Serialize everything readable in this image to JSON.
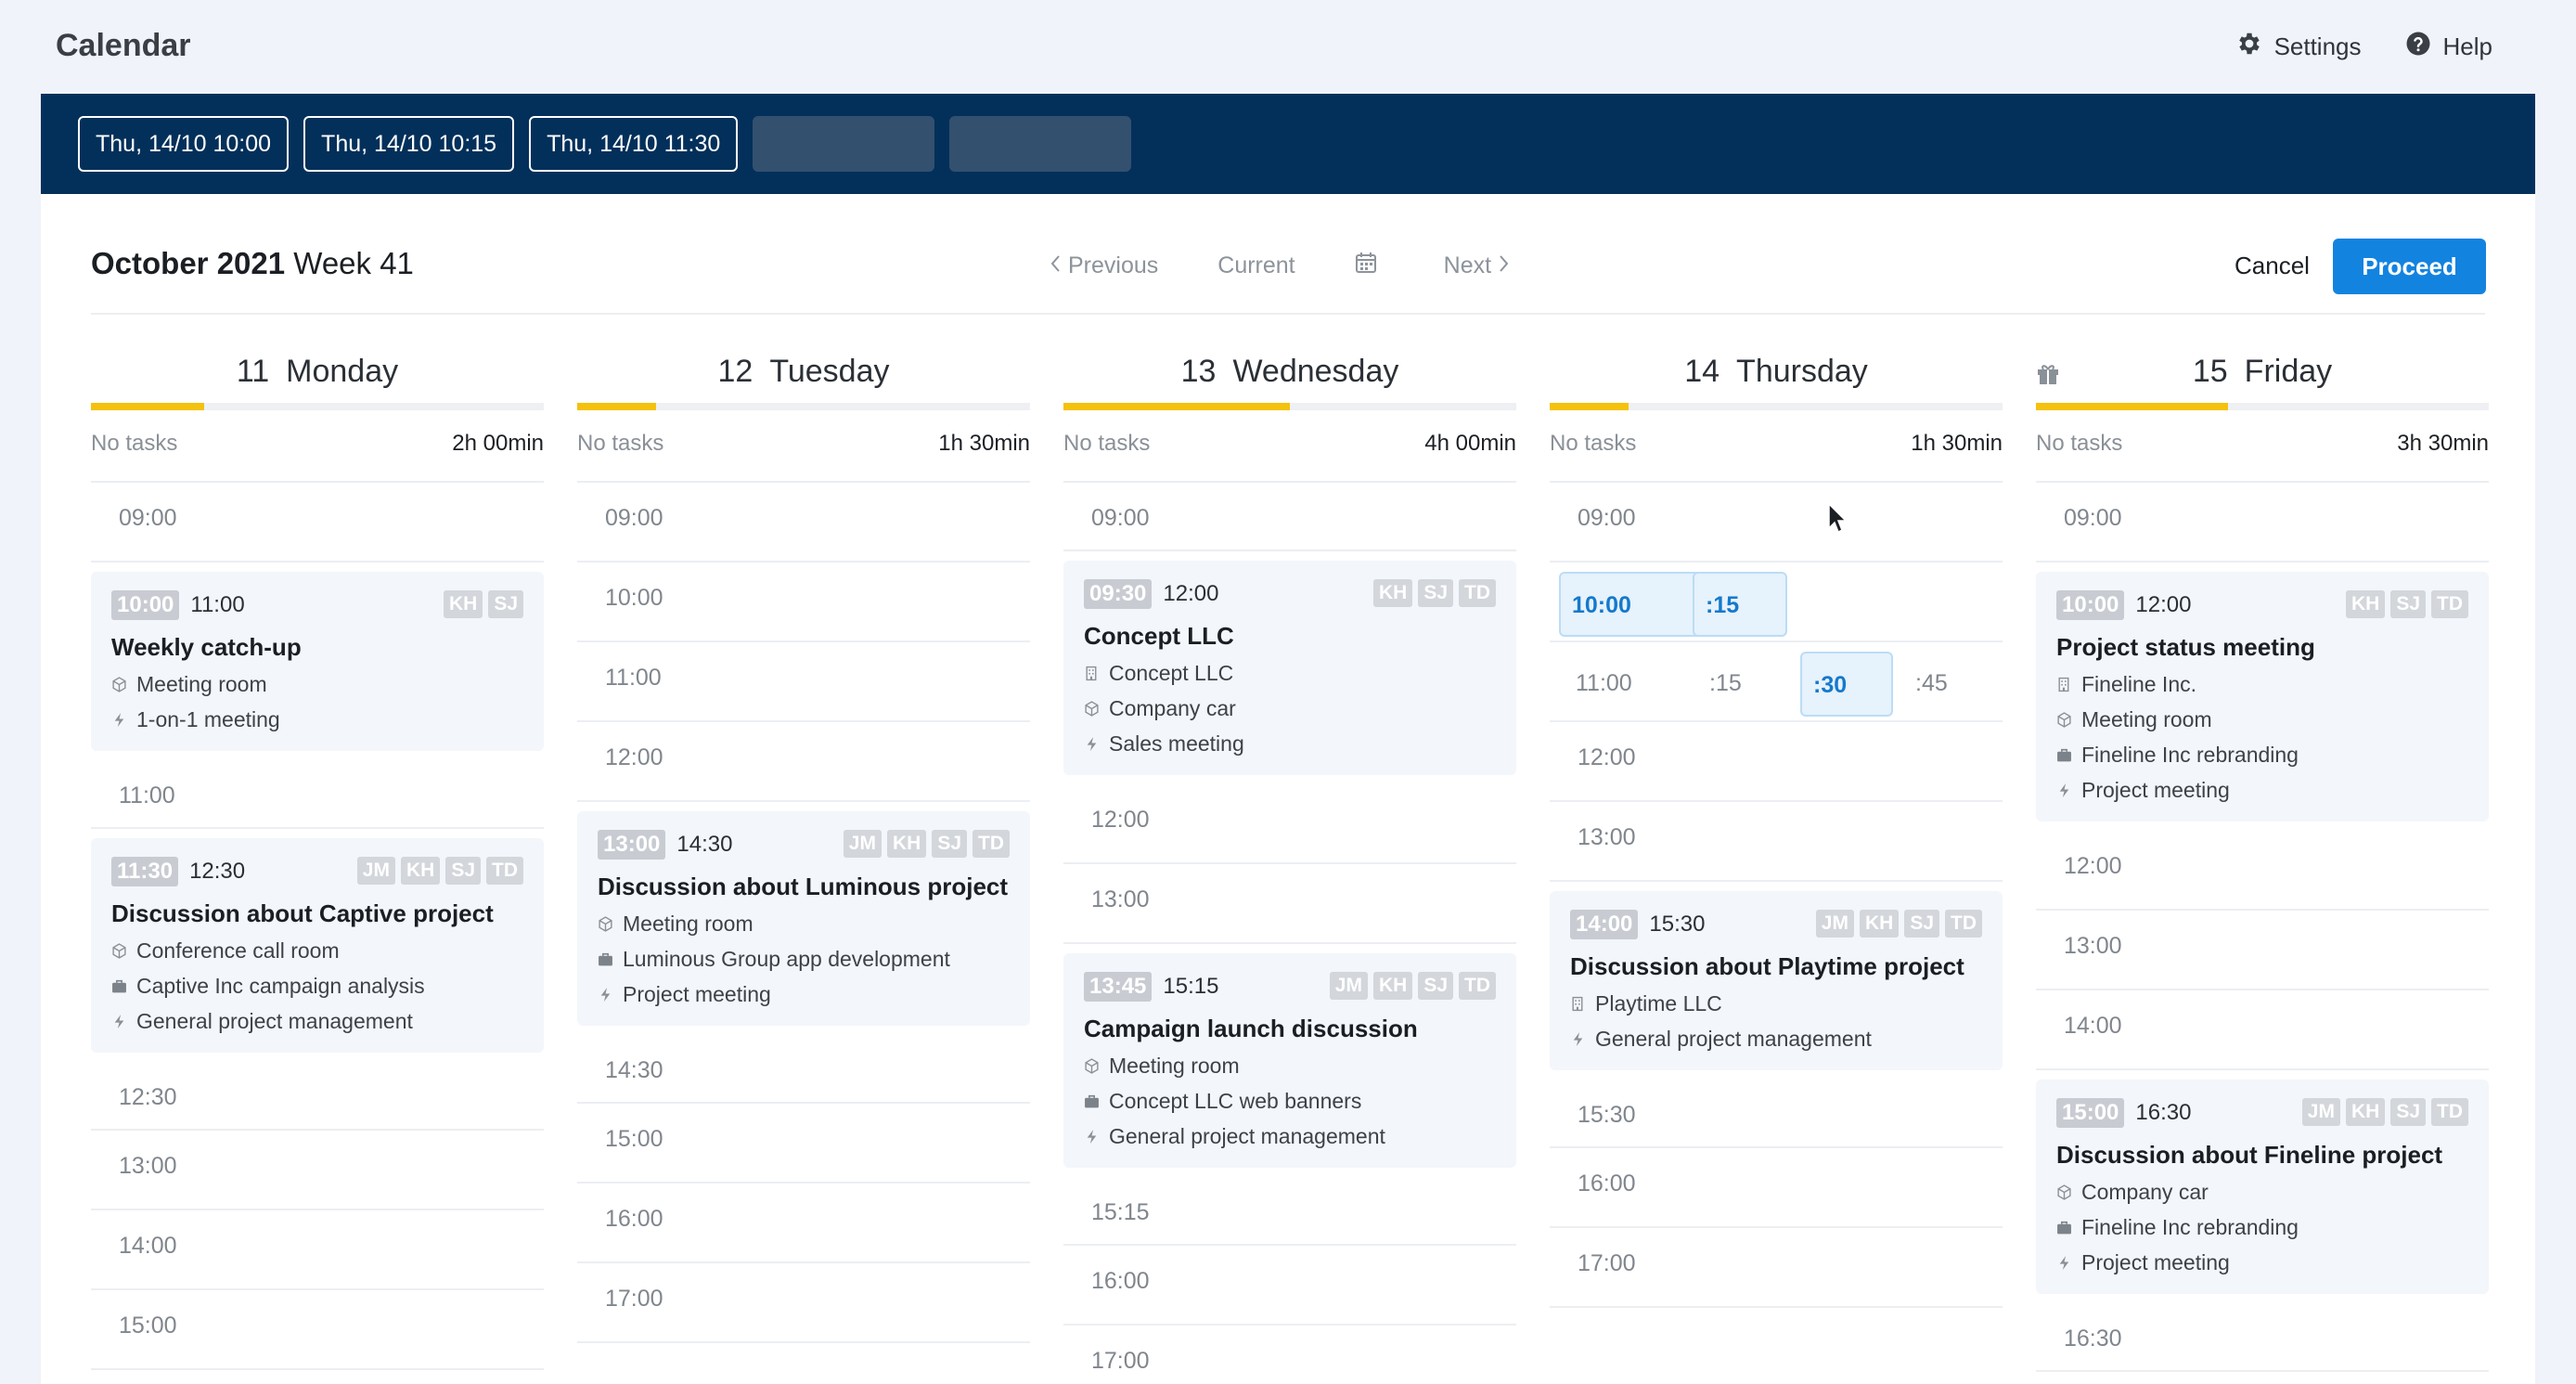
{
  "app": {
    "title": "Calendar",
    "settings_label": "Settings",
    "help_label": "Help"
  },
  "selected_slots": [
    "Thu, 14/10 10:00",
    "Thu, 14/10 10:15",
    "Thu, 14/10 11:30"
  ],
  "empty_slot_count": 2,
  "colors": {
    "navy": "#03305a",
    "accent": "#1383e0",
    "progress": "#f4c20d"
  },
  "header": {
    "month": "October 2021",
    "week": "Week 41",
    "prev_label": "Previous",
    "current_label": "Current",
    "next_label": "Next",
    "cancel_label": "Cancel",
    "proceed_label": "Proceed"
  },
  "days": [
    {
      "num": "11",
      "name": "Monday",
      "tasks": "No tasks",
      "duration": "2h 00min",
      "progress": 0.25,
      "slots": [
        {
          "type": "time",
          "label": "09:00"
        },
        {
          "type": "event",
          "start": "10:00",
          "end": "11:00",
          "badges": [
            "KH",
            "SJ"
          ],
          "title": "Weekly catch-up",
          "lines": [
            {
              "icon": "cube-icon",
              "text": "Meeting room"
            },
            {
              "icon": "bolt-icon",
              "text": "1-on-1 meeting"
            }
          ]
        },
        {
          "type": "time",
          "label": "11:00",
          "short": true
        },
        {
          "type": "event",
          "start": "11:30",
          "end": "12:30",
          "badges": [
            "JM",
            "KH",
            "SJ",
            "TD"
          ],
          "title": "Discussion about Captive project",
          "lines": [
            {
              "icon": "cube-icon",
              "text": "Conference call room"
            },
            {
              "icon": "briefcase-icon",
              "text": "Captive Inc campaign analysis"
            },
            {
              "icon": "bolt-icon",
              "text": "General project management"
            }
          ]
        },
        {
          "type": "time",
          "label": "12:30",
          "short": true
        },
        {
          "type": "time",
          "label": "13:00"
        },
        {
          "type": "time",
          "label": "14:00"
        },
        {
          "type": "time",
          "label": "15:00"
        }
      ]
    },
    {
      "num": "12",
      "name": "Tuesday",
      "tasks": "No tasks",
      "duration": "1h 30min",
      "progress": 0.175,
      "slots": [
        {
          "type": "time",
          "label": "09:00"
        },
        {
          "type": "time",
          "label": "10:00"
        },
        {
          "type": "time",
          "label": "11:00"
        },
        {
          "type": "time",
          "label": "12:00"
        },
        {
          "type": "event",
          "start": "13:00",
          "end": "14:30",
          "badges": [
            "JM",
            "KH",
            "SJ",
            "TD"
          ],
          "title": "Discussion about Luminous project",
          "lines": [
            {
              "icon": "cube-icon",
              "text": "Meeting room"
            },
            {
              "icon": "briefcase-icon",
              "text": "Luminous Group app development"
            },
            {
              "icon": "bolt-icon",
              "text": "Project meeting"
            }
          ]
        },
        {
          "type": "time",
          "label": "14:30",
          "short": true
        },
        {
          "type": "time",
          "label": "15:00"
        },
        {
          "type": "time",
          "label": "16:00"
        },
        {
          "type": "time",
          "label": "17:00"
        }
      ]
    },
    {
      "num": "13",
      "name": "Wednesday",
      "tasks": "No tasks",
      "duration": "4h 00min",
      "progress": 0.5,
      "slots": [
        {
          "type": "time",
          "label": "09:00",
          "short": true
        },
        {
          "type": "event",
          "start": "09:30",
          "end": "12:00",
          "badges": [
            "KH",
            "SJ",
            "TD"
          ],
          "title": "Concept LLC",
          "lines": [
            {
              "icon": "building-icon",
              "text": "Concept LLC"
            },
            {
              "icon": "cube-icon",
              "text": "Company car"
            },
            {
              "icon": "bolt-icon",
              "text": "Sales meeting"
            }
          ]
        },
        {
          "type": "time",
          "label": "12:00"
        },
        {
          "type": "time",
          "label": "13:00"
        },
        {
          "type": "event",
          "start": "13:45",
          "end": "15:15",
          "badges": [
            "JM",
            "KH",
            "SJ",
            "TD"
          ],
          "title": "Campaign launch discussion",
          "lines": [
            {
              "icon": "cube-icon",
              "text": "Meeting room"
            },
            {
              "icon": "briefcase-icon",
              "text": "Concept LLC web banners"
            },
            {
              "icon": "bolt-icon",
              "text": "General project management"
            }
          ]
        },
        {
          "type": "time",
          "label": "15:15",
          "short": true
        },
        {
          "type": "time",
          "label": "16:00"
        },
        {
          "type": "time",
          "label": "17:00"
        }
      ]
    },
    {
      "num": "14",
      "name": "Thursday",
      "tasks": "No tasks",
      "duration": "1h 30min",
      "progress": 0.175,
      "slots": [
        {
          "type": "time",
          "label": "09:00"
        },
        {
          "type": "picker",
          "cells": [
            {
              "label": "10:00",
              "selected": true
            },
            {
              "label": ":15",
              "selected": true
            }
          ]
        },
        {
          "type": "picker",
          "cells": [
            {
              "label": "11:00",
              "selected": false
            },
            {
              "label": ":15",
              "selected": false
            },
            {
              "label": ":30",
              "selected": true
            },
            {
              "label": ":45",
              "selected": false
            }
          ]
        },
        {
          "type": "time",
          "label": "12:00"
        },
        {
          "type": "time",
          "label": "13:00"
        },
        {
          "type": "event",
          "start": "14:00",
          "end": "15:30",
          "badges": [
            "JM",
            "KH",
            "SJ",
            "TD"
          ],
          "title": "Discussion about Playtime project",
          "lines": [
            {
              "icon": "building-icon",
              "text": "Playtime LLC"
            },
            {
              "icon": "bolt-icon",
              "text": "General project management"
            }
          ]
        },
        {
          "type": "time",
          "label": "15:30",
          "short": true
        },
        {
          "type": "time",
          "label": "16:00"
        },
        {
          "type": "time",
          "label": "17:00"
        }
      ]
    },
    {
      "num": "15",
      "name": "Friday",
      "tasks": "No tasks",
      "duration": "3h 30min",
      "progress": 0.425,
      "gift": true,
      "slots": [
        {
          "type": "time",
          "label": "09:00"
        },
        {
          "type": "event",
          "start": "10:00",
          "end": "12:00",
          "badges": [
            "KH",
            "SJ",
            "TD"
          ],
          "title": "Project status meeting",
          "lines": [
            {
              "icon": "building-icon",
              "text": "Fineline Inc."
            },
            {
              "icon": "cube-icon",
              "text": "Meeting room"
            },
            {
              "icon": "briefcase-icon",
              "text": "Fineline Inc rebranding"
            },
            {
              "icon": "bolt-icon",
              "text": "Project meeting"
            }
          ]
        },
        {
          "type": "time",
          "label": "12:00"
        },
        {
          "type": "time",
          "label": "13:00"
        },
        {
          "type": "time",
          "label": "14:00"
        },
        {
          "type": "event",
          "start": "15:00",
          "end": "16:30",
          "badges": [
            "JM",
            "KH",
            "SJ",
            "TD"
          ],
          "title": "Discussion about Fineline project",
          "lines": [
            {
              "icon": "cube-icon",
              "text": "Company car"
            },
            {
              "icon": "briefcase-icon",
              "text": "Fineline Inc rebranding"
            },
            {
              "icon": "bolt-icon",
              "text": "Project meeting"
            }
          ]
        },
        {
          "type": "time",
          "label": "16:30",
          "short": true
        }
      ]
    }
  ]
}
